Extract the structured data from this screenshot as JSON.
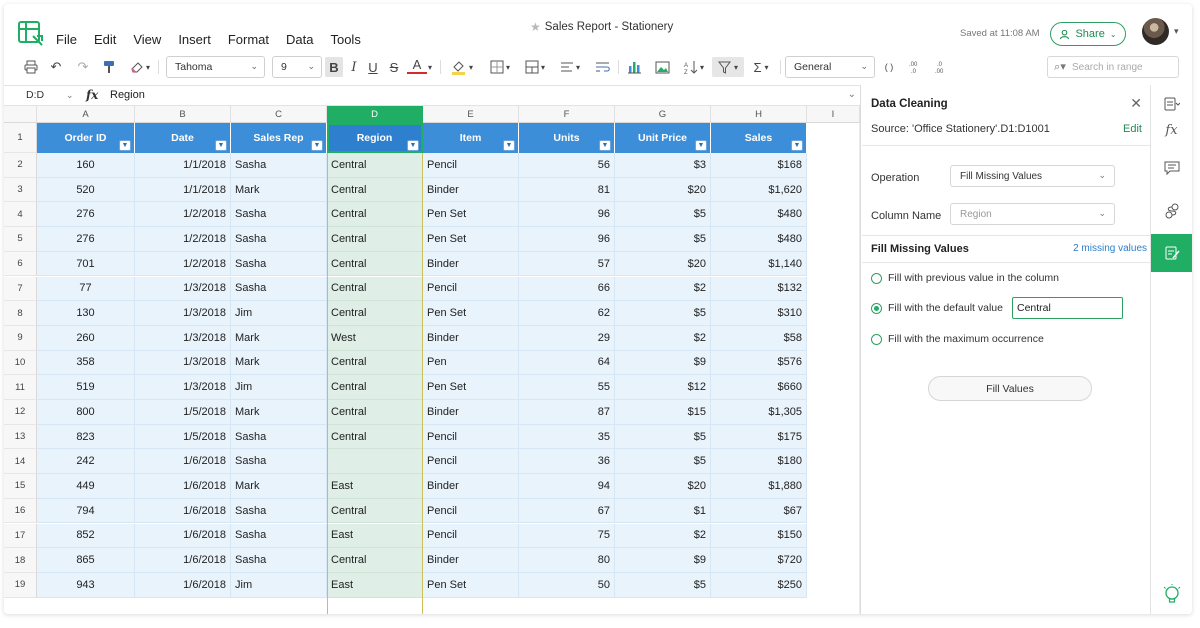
{
  "app": {
    "menu": [
      "File",
      "Edit",
      "View",
      "Insert",
      "Format",
      "Data",
      "Tools"
    ],
    "doc_title": "Sales Report - Stationery",
    "saved_text": "Saved at 11:08 AM",
    "share_label": "Share"
  },
  "toolbar": {
    "font_name": "Tahoma",
    "font_size": "9",
    "number_format": "General",
    "search_placeholder": "Search in range",
    "bold": "B",
    "italic": "I",
    "underline": "U",
    "strike": "S",
    "font_color": "A",
    "sigma": "Σ",
    "paren": "( )"
  },
  "formula_bar": {
    "cell_ref": "D:D",
    "fx": "fx",
    "value": "Region"
  },
  "grid": {
    "col_letters": [
      "A",
      "B",
      "C",
      "D",
      "E",
      "F",
      "G",
      "H",
      "I"
    ],
    "row_numbers": [
      "1",
      "2",
      "3",
      "4",
      "5",
      "6",
      "7",
      "8",
      "9",
      "10",
      "11",
      "12",
      "13",
      "14",
      "15",
      "16",
      "17",
      "18",
      "19"
    ],
    "headers": [
      "Order ID",
      "Date",
      "Sales Rep",
      "Region",
      "Item",
      "Units",
      "Unit Price",
      "Sales"
    ],
    "rows": [
      [
        "160",
        "1/1/2018",
        "Sasha",
        "Central",
        "Pencil",
        "56",
        "$3",
        "$168"
      ],
      [
        "520",
        "1/1/2018",
        "Mark",
        "Central",
        "Binder",
        "81",
        "$20",
        "$1,620"
      ],
      [
        "276",
        "1/2/2018",
        "Sasha",
        "Central",
        "Pen Set",
        "96",
        "$5",
        "$480"
      ],
      [
        "276",
        "1/2/2018",
        "Sasha",
        "Central",
        "Pen Set",
        "96",
        "$5",
        "$480"
      ],
      [
        "701",
        "1/2/2018",
        "Sasha",
        "Central",
        "Binder",
        "57",
        "$20",
        "$1,140"
      ],
      [
        "77",
        "1/3/2018",
        "Sasha",
        "Central",
        "Pencil",
        "66",
        "$2",
        "$132"
      ],
      [
        "130",
        "1/3/2018",
        "Jim",
        "Central",
        "Pen Set",
        "62",
        "$5",
        "$310"
      ],
      [
        "260",
        "1/3/2018",
        "Mark",
        "West",
        "Binder",
        "29",
        "$2",
        "$58"
      ],
      [
        "358",
        "1/3/2018",
        "Mark",
        "Central",
        "Pen",
        "64",
        "$9",
        "$576"
      ],
      [
        "519",
        "1/3/2018",
        "Jim",
        "Central",
        "Pen Set",
        "55",
        "$12",
        "$660"
      ],
      [
        "800",
        "1/5/2018",
        "Mark",
        "Central",
        "Binder",
        "87",
        "$15",
        "$1,305"
      ],
      [
        "823",
        "1/5/2018",
        "Sasha",
        "Central",
        "Pencil",
        "35",
        "$5",
        "$175"
      ],
      [
        "242",
        "1/6/2018",
        "Sasha",
        "",
        "Pencil",
        "36",
        "$5",
        "$180"
      ],
      [
        "449",
        "1/6/2018",
        "Mark",
        "East",
        "Binder",
        "94",
        "$20",
        "$1,880"
      ],
      [
        "794",
        "1/6/2018",
        "Sasha",
        "Central",
        "Pencil",
        "67",
        "$1",
        "$67"
      ],
      [
        "852",
        "1/6/2018",
        "Sasha",
        "East",
        "Pencil",
        "75",
        "$2",
        "$150"
      ],
      [
        "865",
        "1/6/2018",
        "Sasha",
        "Central",
        "Binder",
        "80",
        "$9",
        "$720"
      ],
      [
        "943",
        "1/6/2018",
        "Jim",
        "East",
        "Pen Set",
        "50",
        "$5",
        "$250"
      ]
    ]
  },
  "panel": {
    "title": "Data Cleaning",
    "source": "Source:  'Office Stationery'.D1:D1001",
    "edit_label": "Edit",
    "operation_label": "Operation",
    "operation_value": "Fill Missing Values",
    "column_label": "Column Name",
    "column_value": "Region",
    "section_title": "Fill Missing Values",
    "missing_text": "2 missing values",
    "options": [
      "Fill with previous value in the column",
      "Fill with the default value",
      "Fill with the maximum occurrence"
    ],
    "selected_option": 1,
    "default_value": "Central",
    "fill_button": "Fill Values"
  },
  "colors": {
    "accent_green": "#1fae63",
    "header_blue": "#3d8ed8",
    "cell_blue": "#e9f3fc"
  }
}
